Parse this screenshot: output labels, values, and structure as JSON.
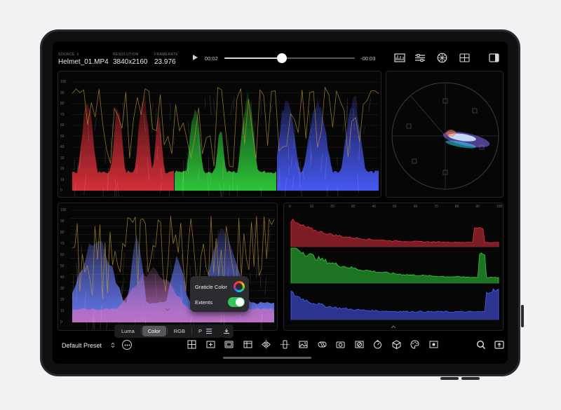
{
  "header": {
    "source": {
      "label": "SOURCE",
      "value": "Helmet_01.MP4"
    },
    "resolution": {
      "label": "RESOLUTION",
      "value": "3840x2160"
    },
    "framerate": {
      "label": "FRAMERATE",
      "value": "23.976"
    },
    "elapsed": "00:02",
    "remaining": "-00:03",
    "playback_progress": 0.44,
    "tools": [
      "waveform-icon",
      "parade-icon",
      "vectorscope-icon",
      "grid-layout-icon",
      "sidebar-icon"
    ]
  },
  "waveform_ticks": [
    "100",
    "90",
    "80",
    "70",
    "60",
    "50",
    "40",
    "30",
    "20",
    "10",
    "0"
  ],
  "histogram_ticks": [
    "0",
    "10",
    "20",
    "30",
    "40",
    "50",
    "60",
    "70",
    "80",
    "90",
    "100"
  ],
  "scope_controls": {
    "options": [
      "Luma",
      "Color",
      "RGB",
      "Parade"
    ],
    "selected": "Color"
  },
  "popover": {
    "graticule_label": "Graticle Color",
    "extents_label": "Extents",
    "extents_on": true
  },
  "bottom": {
    "preset": "Default Preset",
    "scope_icons": [
      "crosshair-grid-icon",
      "plus-frame-icon",
      "monitor-frame-icon",
      "crop-frame-icon",
      "flip-horizontal-icon",
      "flip-vertical-icon",
      "image-icon",
      "zebra-icon",
      "camera-icon",
      "false-color-icon",
      "timer-icon",
      "cube-icon",
      "palette-icon",
      "record-frame-icon"
    ]
  },
  "colors": {
    "red": "#e0303a",
    "green": "#2fcf3a",
    "blue": "#4a5cff",
    "accent_toggle": "#34c759",
    "waveform_trace": "#c8a030"
  }
}
